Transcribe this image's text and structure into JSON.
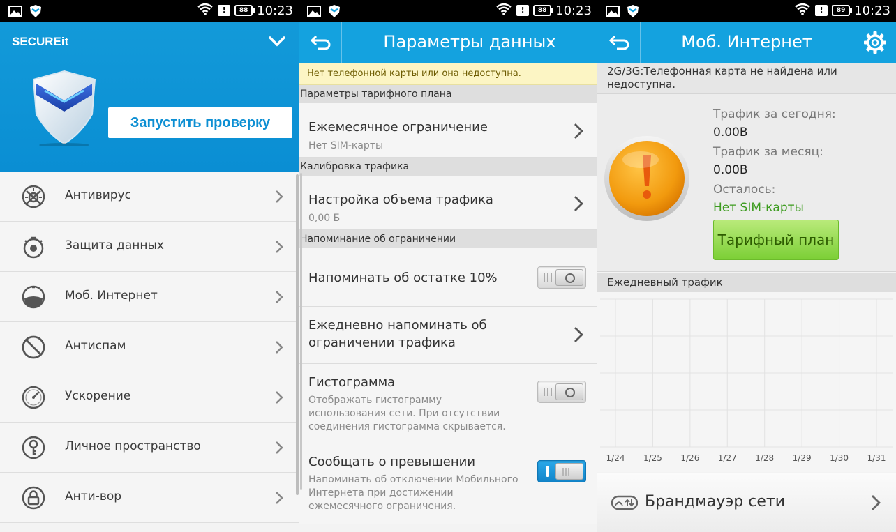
{
  "status": {
    "time_1": "10:23",
    "time_2": "10:23",
    "time_3": "10:23",
    "battery_1": "88",
    "battery_2": "88",
    "battery_3": "89",
    "alert": "!"
  },
  "screen1": {
    "brand": "SECUREit",
    "scan_button": "Запустить проверку",
    "items": [
      {
        "label": "Антивирус",
        "icon": "antivirus-icon"
      },
      {
        "label": "Защита данных",
        "icon": "data-protection-icon"
      },
      {
        "label": "Моб. Интернет",
        "icon": "mobile-internet-icon"
      },
      {
        "label": "Антиспам",
        "icon": "antispam-icon"
      },
      {
        "label": "Ускорение",
        "icon": "speedometer-icon"
      },
      {
        "label": "Личное пространство",
        "icon": "key-icon"
      },
      {
        "label": "Анти-вор",
        "icon": "lock-icon"
      }
    ]
  },
  "screen2": {
    "title": "Параметры данных",
    "warning": "Нет телефонной карты или она недоступна.",
    "section_plan": "Параметры тарифного плана",
    "monthly_limit_title": "Ежемесячное ограничение",
    "monthly_limit_sub": "Нет SIM-карты",
    "section_calibration": "Калибровка трафика",
    "traffic_volume_title": "Настройка объема трафика",
    "traffic_volume_sub": "0,00 Б",
    "section_reminder": "Напоминание об ограничении",
    "remind10_title": "Напоминать об остатке 10%",
    "remind10_on": false,
    "daily_remind_line1": "Ежедневно напоминать об",
    "daily_remind_line2": "ограничении трафика",
    "histogram_title": "Гистограмма",
    "histogram_sub_1": "Отображать гистограмму",
    "histogram_sub_2": "использования сети. При отсутствии",
    "histogram_sub_3": "соединения гистограмма скрывается.",
    "histogram_on": false,
    "exceed_title": "Сообщать о превышении",
    "exceed_sub_1": "Напоминать об отключении Мобильного",
    "exceed_sub_2": "Интернета при достижении",
    "exceed_sub_3": "ежемесячного ограничения.",
    "exceed_on": true
  },
  "screen3": {
    "title": "Моб. Интернет",
    "note_line1": "2G/3G:Телефонная карта не найдена или",
    "note_line2": "недоступна.",
    "today_label": "Трафик за сегодня:",
    "today_value": "0.00B",
    "month_label": "Трафик за месяц:",
    "month_value": "0.00B",
    "remaining_label": "Осталось:",
    "remaining_value": "Нет SIM-карты",
    "plan_button": "Тарифный план",
    "daily_section": "Ежедневный трафик",
    "firewall": "Брандмауэр сети"
  },
  "chart_data": {
    "type": "line",
    "categories": [
      "1/24",
      "1/25",
      "1/26",
      "1/27",
      "1/28",
      "1/29",
      "1/30",
      "1/31"
    ],
    "values": [
      0,
      0,
      0,
      0,
      0,
      0,
      0,
      0
    ],
    "title": "Ежедневный трафик",
    "xlabel": "",
    "ylabel": "",
    "grid": true
  },
  "colors": {
    "accent": "#14a2df",
    "warning_bg": "#fcf5c4",
    "plan_green": "#7ccf36",
    "nosim_green": "#3c9b1e"
  }
}
